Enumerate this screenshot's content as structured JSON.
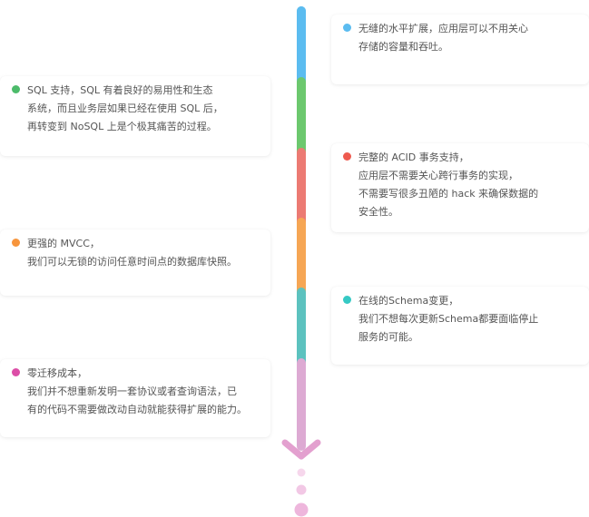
{
  "cards": [
    {
      "side": "right",
      "color": "#5bbcf0",
      "text": "无缝的水平扩展，应用层可以不用关心\n存储的容量和吞吐。"
    },
    {
      "side": "left",
      "color": "#4cbb6a",
      "text": "SQL 支持，SQL 有着良好的易用性和生态\n系统，而且业务层如果已经在使用 SQL 后，\n再转变到 NoSQL 上是个极其痛苦的过程。"
    },
    {
      "side": "right",
      "color": "#ee5a4f",
      "text": "完整的 ACID 事务支持，\n应用层不需要关心跨行事务的实现，\n不需要写很多丑陋的 hack 来确保数据的\n安全性。"
    },
    {
      "side": "left",
      "color": "#f7953c",
      "text": "更强的 MVCC，\n我们可以无锁的访问任意时间点的数据库快照。"
    },
    {
      "side": "right",
      "color": "#36c9c4",
      "text": "在线的Schema变更，\n我们不想每次更新Schema都要面临停止\n服务的可能。"
    },
    {
      "side": "left",
      "color": "#dc4ea7",
      "text": "零迁移成本，\n我们并不想重新发明一套协议或者查询语法，已\n有的代码不需要做改动自动就能获得扩展的能力。"
    }
  ],
  "timeline": {
    "segments": [
      "#5bbcf0",
      "#6cc86e",
      "#ec7a73",
      "#f6a654",
      "#5cc2bf",
      "#ddaad3"
    ],
    "arrow_color": "#de8fc7",
    "trail_color": "#eeb6dc"
  }
}
